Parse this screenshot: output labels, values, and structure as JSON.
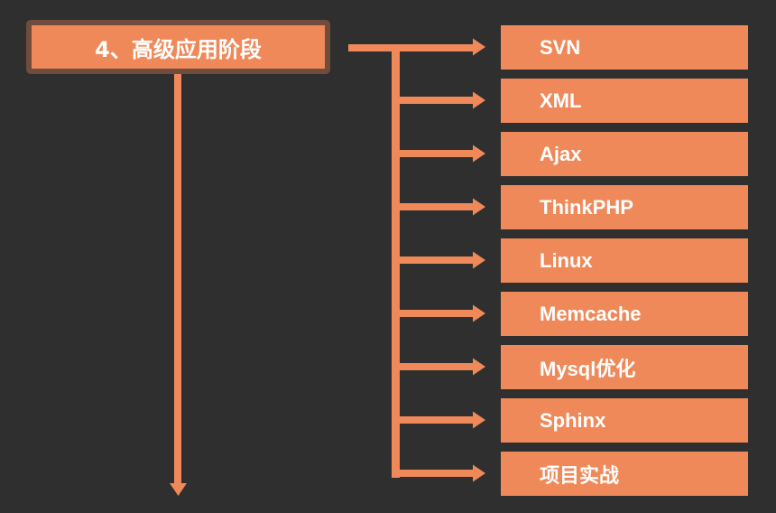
{
  "diagram": {
    "title": "4、高级应用阶段",
    "colors": {
      "box": "#F0895A",
      "title_border": "#6F4C3C",
      "background": "#2E2F2E",
      "text": "#FFFFFF"
    },
    "items": [
      {
        "label": "SVN"
      },
      {
        "label": "XML"
      },
      {
        "label": "Ajax"
      },
      {
        "label": "ThinkPHP"
      },
      {
        "label": "Linux"
      },
      {
        "label": "Memcache"
      },
      {
        "label": "Mysql优化"
      },
      {
        "label": "Sphinx"
      },
      {
        "label": "项目实战"
      }
    ]
  }
}
